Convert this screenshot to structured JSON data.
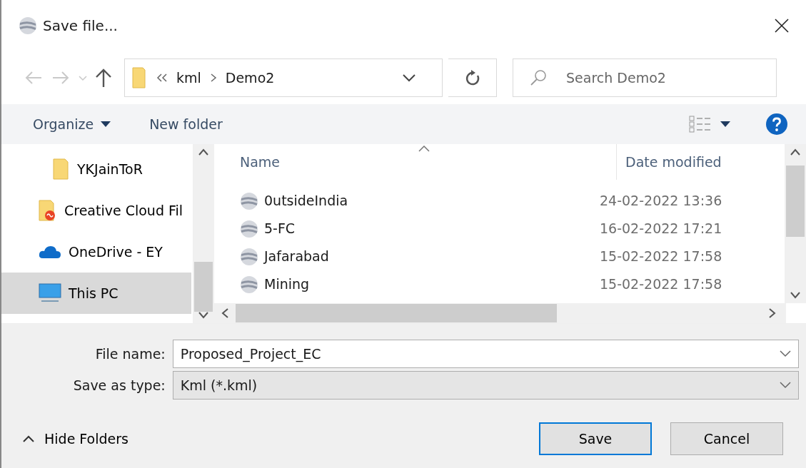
{
  "window": {
    "title": "Save file..."
  },
  "address": {
    "path": [
      "kml",
      "Demo2"
    ]
  },
  "search": {
    "placeholder": "Search Demo2"
  },
  "toolbar": {
    "organize": "Organize",
    "new_folder": "New folder"
  },
  "sidebar": {
    "items": [
      {
        "label": "YKJainToR",
        "kind": "folder",
        "selected": false,
        "indent": true
      },
      {
        "label": "Creative Cloud Fil",
        "kind": "cloud-folder",
        "selected": false,
        "indent": false
      },
      {
        "label": "OneDrive - EY",
        "kind": "onedrive",
        "selected": false,
        "indent": false
      },
      {
        "label": "This PC",
        "kind": "pc",
        "selected": true,
        "indent": false
      }
    ]
  },
  "table": {
    "columns": [
      {
        "label": "Name",
        "sorted": true
      },
      {
        "label": "Date modified",
        "sorted": false
      }
    ],
    "rows": [
      {
        "name": "0utsideIndia",
        "date": "24-02-2022 13:36",
        "selected": false
      },
      {
        "name": "5-FC",
        "date": "16-02-2022 17:21",
        "selected": false
      },
      {
        "name": "Jafarabad",
        "date": "15-02-2022 17:58",
        "selected": false
      },
      {
        "name": "Mining",
        "date": "15-02-2022 17:58",
        "selected": false
      }
    ]
  },
  "form": {
    "file_name_label": "File name:",
    "file_name": "Proposed_Project_EC",
    "type_label": "Save as type:",
    "type": "Kml (*.kml)"
  },
  "footer": {
    "hide_folders": "Hide Folders",
    "buttons": [
      {
        "label": "Save",
        "default": true
      },
      {
        "label": "Cancel",
        "default": false
      }
    ]
  }
}
